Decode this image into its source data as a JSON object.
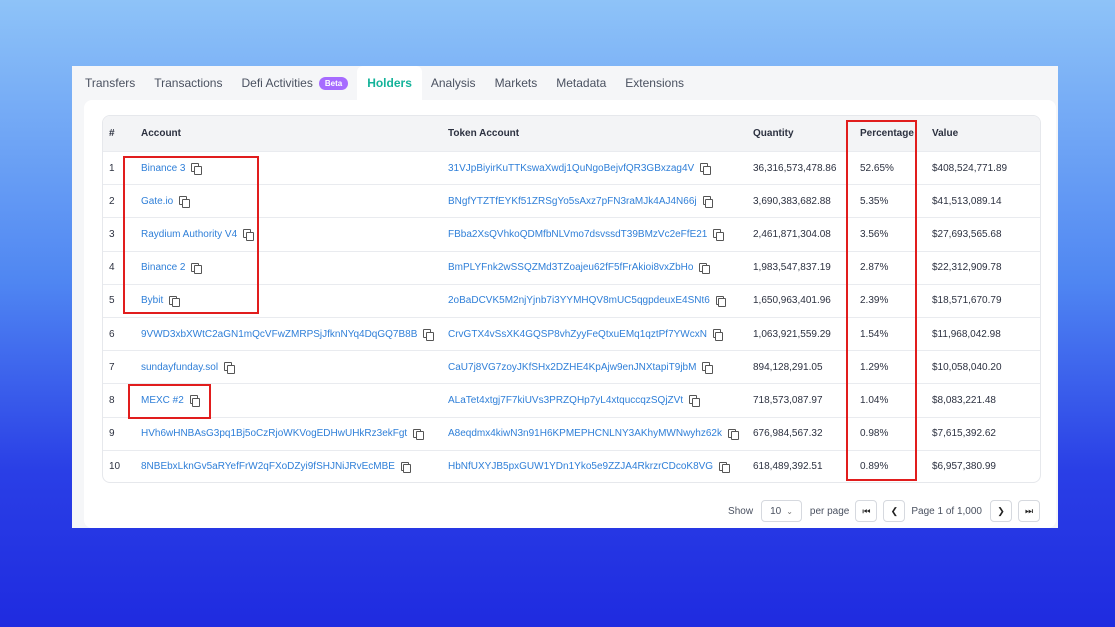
{
  "tabs": [
    {
      "label": "Transfers"
    },
    {
      "label": "Transactions"
    },
    {
      "label": "Defi Activities",
      "badge": "Beta"
    },
    {
      "label": "Holders",
      "active": true
    },
    {
      "label": "Analysis"
    },
    {
      "label": "Markets"
    },
    {
      "label": "Metadata"
    },
    {
      "label": "Extensions"
    }
  ],
  "table": {
    "headers": {
      "num": "#",
      "account": "Account",
      "token_account": "Token Account",
      "quantity": "Quantity",
      "percentage": "Percentage",
      "value": "Value"
    },
    "rows": [
      {
        "num": "1",
        "account": "Binance 3",
        "token_account": "31VJpBiyirKuTTKswaXwdj1QuNgoBejvfQR3GBxzag4V",
        "quantity": "36,316,573,478.86",
        "percentage": "52.65%",
        "value": "$408,524,771.89"
      },
      {
        "num": "2",
        "account": "Gate.io",
        "token_account": "BNgfYTZTfEYKf51ZRSgYo5sAxz7pFN3raMJk4AJ4N66j",
        "quantity": "3,690,383,682.88",
        "percentage": "5.35%",
        "value": "$41,513,089.14"
      },
      {
        "num": "3",
        "account": "Raydium Authority V4",
        "token_account": "FBba2XsQVhkoQDMfbNLVmo7dsvssdT39BMzVc2eFfE21",
        "quantity": "2,461,871,304.08",
        "percentage": "3.56%",
        "value": "$27,693,565.68"
      },
      {
        "num": "4",
        "account": "Binance 2",
        "token_account": "BmPLYFnk2wSSQZMd3TZoajeu62fF5fFrAkioi8vxZbHo",
        "quantity": "1,983,547,837.19",
        "percentage": "2.87%",
        "value": "$22,312,909.78"
      },
      {
        "num": "5",
        "account": "Bybit",
        "token_account": "2oBaDCVK5M2njYjnb7i3YYMHQV8mUC5qgpdeuxE4SNt6",
        "quantity": "1,650,963,401.96",
        "percentage": "2.39%",
        "value": "$18,571,670.79"
      },
      {
        "num": "6",
        "account": "9VWD3xbXWtC2aGN1mQcVFwZMRPSjJfknNYq4DqGQ7B8B",
        "token_account": "CrvGTX4vSsXK4GQSP8vhZyyFeQtxuEMq1qztPf7YWcxN",
        "quantity": "1,063,921,559.29",
        "percentage": "1.54%",
        "value": "$11,968,042.98"
      },
      {
        "num": "7",
        "account": "sundayfunday.sol",
        "token_account": "CaU7j8VG7zoyJKfSHx2DZHE4KpAjw9enJNXtapiT9jbM",
        "quantity": "894,128,291.05",
        "percentage": "1.29%",
        "value": "$10,058,040.20"
      },
      {
        "num": "8",
        "account": "MEXC #2",
        "token_account": "ALaTet4xtgj7F7kiUVs3PRZQHp7yL4xtquccqzSQjZVt",
        "quantity": "718,573,087.97",
        "percentage": "1.04%",
        "value": "$8,083,221.48"
      },
      {
        "num": "9",
        "account": "HVh6wHNBAsG3pq1Bj5oCzRjoWKVogEDHwUHkRz3ekFgt",
        "token_account": "A8eqdmx4kiwN3n91H6KPMEPHCNLNY3AKhyMWNwyhz62k",
        "quantity": "676,984,567.32",
        "percentage": "0.98%",
        "value": "$7,615,392.62"
      },
      {
        "num": "10",
        "account": "8NBEbxLknGv5aRYefFrW2qFXoDZyi9fSHJNiJRvEcMBE",
        "token_account": "HbNfUXYJB5pxGUW1YDn1Yko5e9ZZJA4RkrzrCDcoK8VG",
        "quantity": "618,489,392.51",
        "percentage": "0.89%",
        "value": "$6,957,380.99"
      }
    ]
  },
  "pagination": {
    "show_label": "Show",
    "page_size": "10",
    "per_page_label": "per page",
    "page_text": "Page 1 of 1,000"
  },
  "icons": [
    "copy-icon",
    "chevron-down-icon",
    "first-page-icon",
    "prev-page-icon",
    "next-page-icon",
    "last-page-icon"
  ],
  "colors": {
    "accent": "#14b39a",
    "link": "#2f7fd8",
    "highlight": "#e11d1d",
    "beta": "#a66bff"
  }
}
